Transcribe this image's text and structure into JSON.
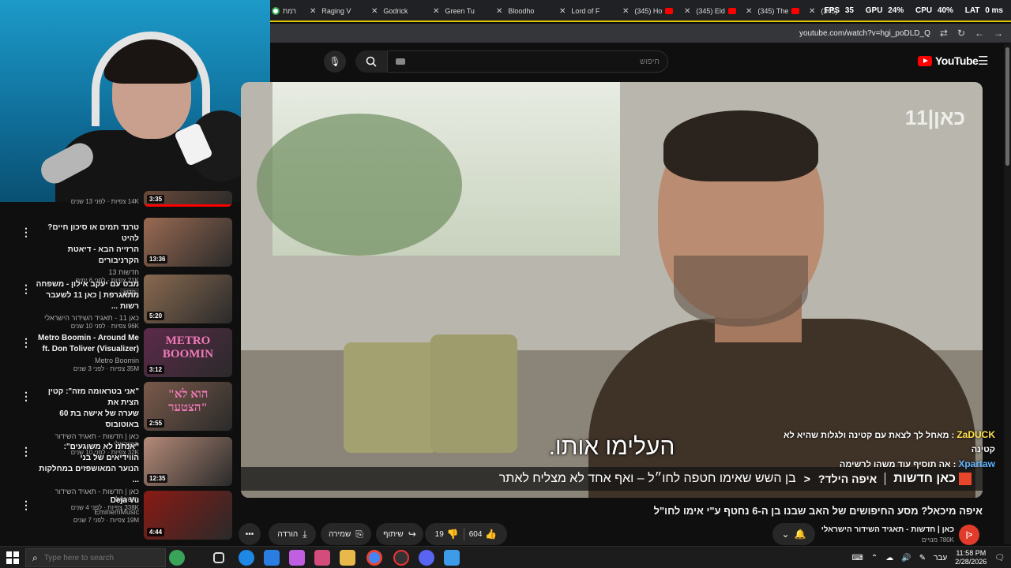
{
  "browser": {
    "tabs": [
      {
        "label": "רמת",
        "fav": "globe"
      },
      {
        "label": "Raging V",
        "fav": "none"
      },
      {
        "label": "Godrick",
        "fav": "none"
      },
      {
        "label": "Green Tu",
        "fav": "none"
      },
      {
        "label": "Bloodho",
        "fav": "none"
      },
      {
        "label": "Lord of F",
        "fav": "none"
      },
      {
        "label": "(345) Ho",
        "fav": "yt"
      },
      {
        "label": "(345) Eld",
        "fav": "yt"
      },
      {
        "label": "(345) The",
        "fav": "yt"
      },
      {
        "label": "(345)",
        "fav": "yt"
      }
    ],
    "perf": {
      "fps_label": "FPS",
      "fps": "35",
      "gpu_label": "GPU",
      "gpu": "24%",
      "cpu_label": "CPU",
      "cpu": "40%",
      "lat_label": "LAT",
      "lat": "0 ms"
    },
    "url": "youtube.com/watch?v=hgi_poDLD_Q"
  },
  "header": {
    "search_placeholder": "חיפוש",
    "logo": "YouTube"
  },
  "recommendations": [
    {
      "title_line1": "",
      "title_line2": "",
      "channel": "",
      "stats": "14K צפיות · לפני 13 שנים",
      "duration": "3:35",
      "progress": 1.0,
      "thumb_color": "#6b4a3a",
      "partial": true
    },
    {
      "title_line1": "טרנד תמים או סיכון חיים? להיט",
      "title_line2": "הרזייה הבא - דיאטת הקרניבורים",
      "channel": "חדשות 13",
      "stats": "21K צפיות · לפני 6 ימים",
      "badge": "חדש",
      "duration": "13:36",
      "progress": 0,
      "thumb_color": "#9a6a52"
    },
    {
      "title_line1": "מבט עם יעקב אילון - משפחה",
      "title_line2": "מתאגרפת | כאן 11 לשעבר רשות ...",
      "channel": "כאן 11 - תאגיד השידור הישראלי",
      "stats": "96K צפיות · לפני 10 שנים",
      "duration": "5:20",
      "progress": 0,
      "thumb_color": "#8a6a50"
    },
    {
      "title_line1": "Metro Boomin - Around Me",
      "title_line2": "(Visualizer) ft. Don Toliver",
      "channel": "Metro Boomin",
      "stats": "35M צפיות · לפני 3 שנים",
      "duration": "3:12",
      "progress": 0,
      "thumb_color": "#5c2a4a",
      "thumb_text": "METRO BOOMIN"
    },
    {
      "title_line1": "\"אני בטראומה מזה\": קטין הצית את",
      "title_line2": "שערה של אישה בת 60 באוטובוס",
      "channel": "כאן | חדשות - תאגיד השידור הישראלי",
      "stats": "32K צפיות · לפני 10 שנים",
      "duration": "2:55",
      "progress": 0,
      "thumb_color": "#7a5a4a",
      "thumb_text": "\"הוא לא הצטער\""
    },
    {
      "title_line1": "\"אנחנו לא משוגעים\": הווידיאים של בני",
      "title_line2": "הנוער המאושפזים במחלקות ...",
      "channel": "כאן | חדשות - תאגיד השידור הישראלי",
      "stats": "338K צפיות · לפני 4 שנים",
      "duration": "12:35",
      "progress": 0,
      "thumb_color": "#b48a78"
    },
    {
      "title_line1": "Deja Vu",
      "title_line2": "",
      "channel": "EminemMusic",
      "stats": "19M צפיות · לפני 7 שנים",
      "duration": "4:44",
      "progress": 0,
      "thumb_color": "#8a1a14"
    }
  ],
  "player": {
    "watermark": "כאן|11",
    "subtitle": "העלימו אותו.",
    "ticker_brand": "כאן חדשות",
    "ticker_section": "איפה הילד?",
    "ticker_text": "בן השש שאימו חטפה לחו״ל – ואף אחד לא מצליח לאתר"
  },
  "chat": [
    {
      "user": "ZaDUCK",
      "message": ": מאחל לך לצאת עם קטינה ולגלות שהיא לא קטינה",
      "color": "yellow"
    },
    {
      "user": "Xpartaw",
      "message": ": אה תוסיף עוד משהו לרשימה",
      "color": "blue"
    }
  ],
  "video": {
    "title": "איפה מיכאל? מסע החיפושים של האב שבנו בן ה-6 נחטף ע\"י אימו לחו\"ל",
    "channel_name": "כאן | חדשות - תאגיד השידור הישראלי",
    "subscribers": "780K מנויים",
    "likes": "604",
    "dislikes": "19",
    "share_label": "שיתוף",
    "save_label": "שמירה",
    "download_label": "הורדה",
    "more_label": "•••"
  },
  "taskbar": {
    "search_placeholder": "Type here to search",
    "lang": "עבר",
    "time": "11:58 PM",
    "date": "2/28/2026"
  },
  "colors": {
    "accent": "#ff0000",
    "tab_border": "#e1c800",
    "bg": "#0f0f0f"
  }
}
